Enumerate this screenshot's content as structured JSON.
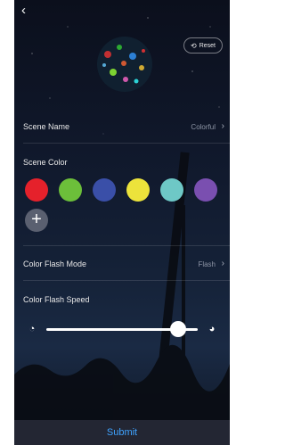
{
  "header": {
    "back_icon": "back-arrow-icon",
    "reset_label": "Reset"
  },
  "scene_name": {
    "label": "Scene Name",
    "value": "Colorful"
  },
  "scene_color": {
    "label": "Scene Color",
    "colors": [
      "#e5212b",
      "#6cbf3a",
      "#3a4fa8",
      "#ece33b",
      "#6ec8c6",
      "#7a4fb0"
    ],
    "add_icon": "plus-icon"
  },
  "flash_mode": {
    "label": "Color Flash Mode",
    "value": "Flash"
  },
  "flash_speed": {
    "label": "Color Flash Speed",
    "level": 0.87,
    "slow_icon": "speed-slow-icon",
    "fast_icon": "speed-fast-icon"
  },
  "footer": {
    "submit_label": "Submit"
  }
}
